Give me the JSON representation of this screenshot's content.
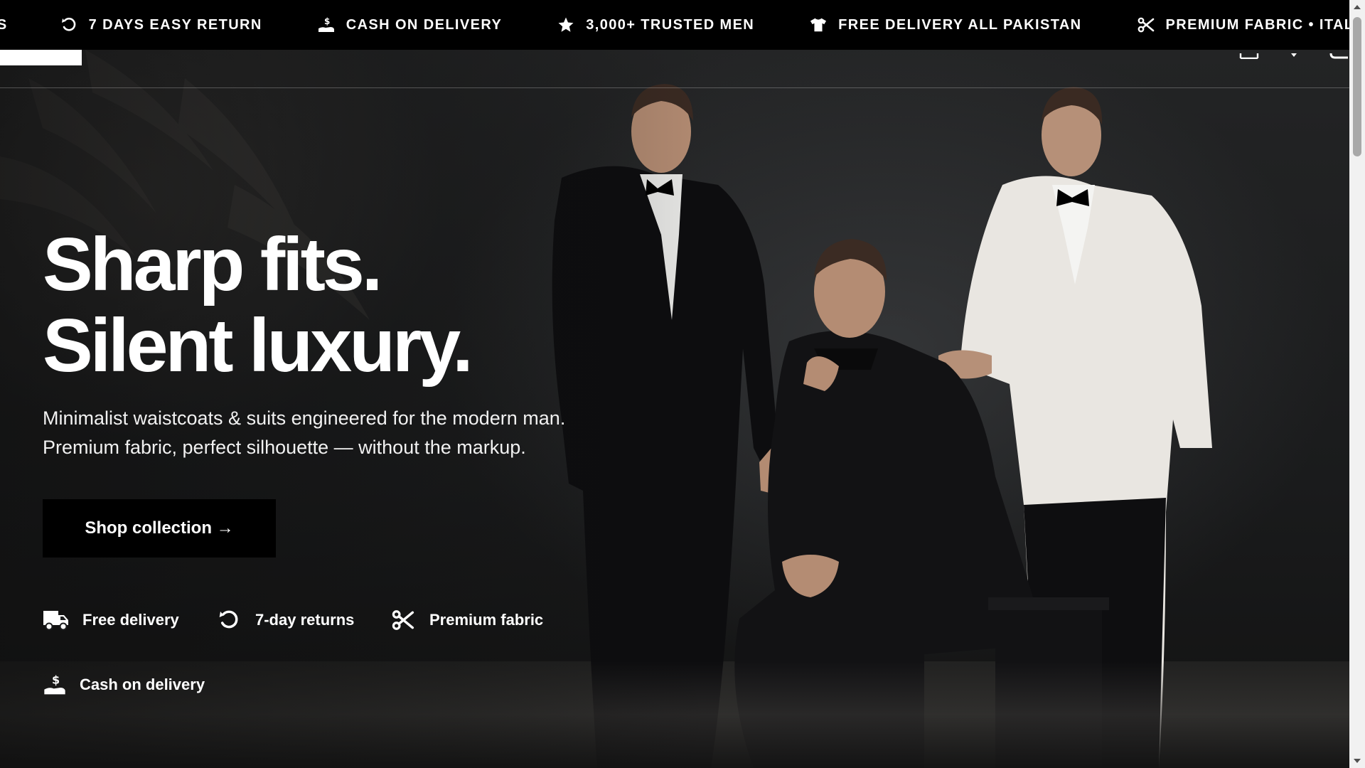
{
  "announcement_bar": {
    "items": [
      {
        "icon": "truck-icon",
        "text": "DS"
      },
      {
        "icon": "return-icon",
        "text": "7 DAYS EASY RETURN"
      },
      {
        "icon": "cash-hand-icon",
        "text": "CASH ON DELIVERY"
      },
      {
        "icon": "star-icon",
        "text": "3,000+ TRUSTED MEN"
      },
      {
        "icon": "tshirt-icon",
        "text": "FREE DELIVERY ALL PAKISTAN"
      },
      {
        "icon": "scissors-icon",
        "text": "PREMIUM FABRIC • ITAL"
      }
    ]
  },
  "header": {
    "icons": [
      "account-icon",
      "search-icon",
      "cart-icon"
    ]
  },
  "hero": {
    "headline_line1": "Sharp fits.",
    "headline_line2": "Silent luxury.",
    "subtext_line1": "Minimalist waistcoats & suits engineered for the modern man.",
    "subtext_line2": "Premium fabric, perfect silhouette — without the markup.",
    "cta_label": "Shop collection →",
    "features": [
      {
        "icon": "truck-icon",
        "label": "Free delivery"
      },
      {
        "icon": "return-icon",
        "label": "7-day returns"
      },
      {
        "icon": "scissors-icon",
        "label": "Premium fabric"
      },
      {
        "icon": "cash-hand-icon",
        "label": "Cash on delivery"
      }
    ]
  },
  "colors": {
    "bar_background": "#000000",
    "hero_text": "#ffffff",
    "cta_background": "#000000"
  }
}
